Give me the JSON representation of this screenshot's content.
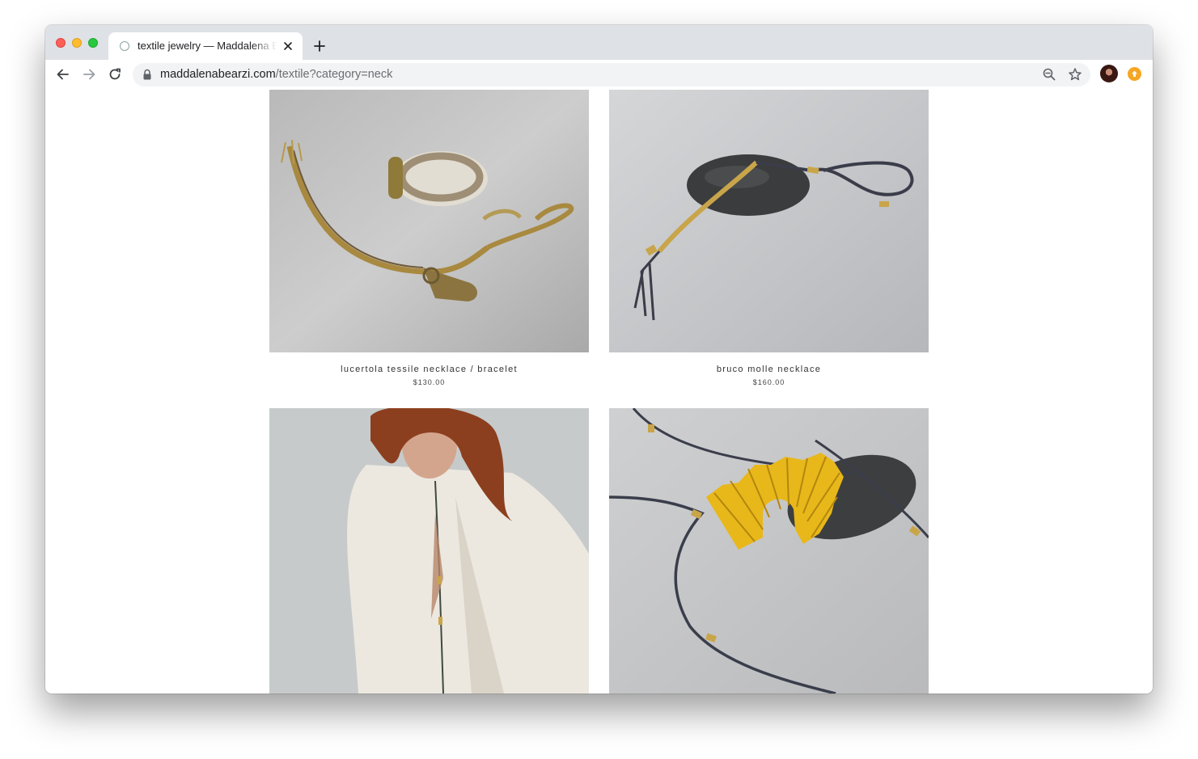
{
  "browser": {
    "tab_title": "textile jewelry — Maddalena Bearzi",
    "url_host": "maddalenabearzi.com",
    "url_path": "/textile?category=neck"
  },
  "products": [
    {
      "title": "lucertola tessile necklace / bracelet",
      "price": "$130.00"
    },
    {
      "title": "bruco molle necklace",
      "price": "$160.00"
    }
  ],
  "colors": {
    "tabstrip": "#dee1e6",
    "photo_background": "#c4c4c4",
    "brass": "#b8922e",
    "gold_fan": "#e8b71a"
  }
}
